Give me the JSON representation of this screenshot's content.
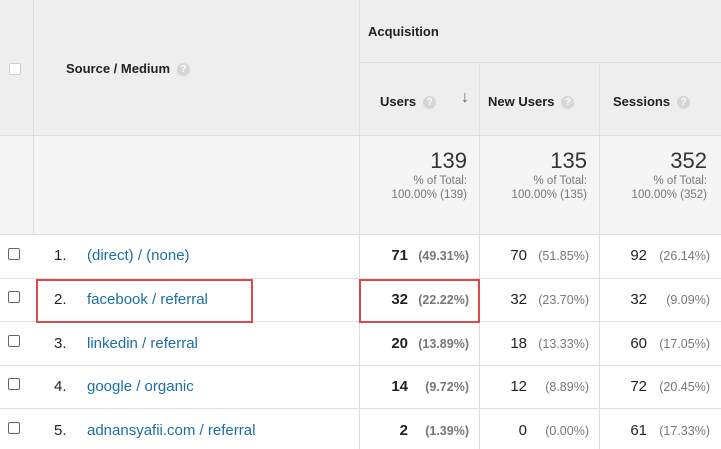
{
  "header": {
    "dimension_label": "Source / Medium",
    "group_label": "Acquisition",
    "columns": [
      "Users",
      "New Users",
      "Sessions"
    ],
    "help_glyph": "?",
    "sort_glyph": "↓"
  },
  "totals": [
    {
      "value": "139",
      "label": "% of Total:",
      "detail": "100.00% (139)"
    },
    {
      "value": "135",
      "label": "% of Total:",
      "detail": "100.00% (135)"
    },
    {
      "value": "352",
      "label": "% of Total:",
      "detail": "100.00% (352)"
    }
  ],
  "rows": [
    {
      "num": "1.",
      "source": "(direct) / (none)",
      "users": "71",
      "users_pct": "(49.31%)",
      "new_users": "70",
      "new_users_pct": "(51.85%)",
      "sessions": "92",
      "sessions_pct": "(26.14%)"
    },
    {
      "num": "2.",
      "source": "facebook / referral",
      "users": "32",
      "users_pct": "(22.22%)",
      "new_users": "32",
      "new_users_pct": "(23.70%)",
      "sessions": "32",
      "sessions_pct": "(9.09%)"
    },
    {
      "num": "3.",
      "source": "linkedin / referral",
      "users": "20",
      "users_pct": "(13.89%)",
      "new_users": "18",
      "new_users_pct": "(13.33%)",
      "sessions": "60",
      "sessions_pct": "(17.05%)"
    },
    {
      "num": "4.",
      "source": "google / organic",
      "users": "14",
      "users_pct": "(9.72%)",
      "new_users": "12",
      "new_users_pct": "(8.89%)",
      "sessions": "72",
      "sessions_pct": "(20.45%)"
    },
    {
      "num": "5.",
      "source": "adnansyafii.com / referral",
      "users": "2",
      "users_pct": "(1.39%)",
      "new_users": "0",
      "new_users_pct": "(0.00%)",
      "sessions": "61",
      "sessions_pct": "(17.33%)"
    }
  ],
  "colors": {
    "link": "#1a6fa6",
    "highlight": "#e0474b",
    "header_bg": "#eeeeee"
  }
}
